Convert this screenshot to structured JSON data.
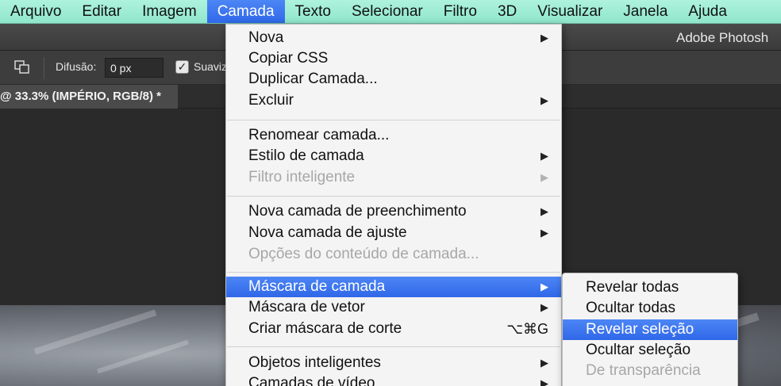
{
  "menubar": {
    "items": [
      "Arquivo",
      "Editar",
      "Imagem",
      "Camada",
      "Texto",
      "Selecionar",
      "Filtro",
      "3D",
      "Visualizar",
      "Janela",
      "Ajuda"
    ],
    "active": "Camada"
  },
  "titlebar": {
    "app_title": "Adobe Photosh"
  },
  "options": {
    "feather_label": "Difusão:",
    "feather_value": "0 px",
    "antialias_label": "Suaviz",
    "antialias_checked": true
  },
  "document": {
    "tab_title": "@ 33.3% (IMPÉRIO, RGB/8) *"
  },
  "menu": {
    "items": [
      {
        "label": "Nova",
        "submenu": true
      },
      {
        "label": "Copiar CSS"
      },
      {
        "label": "Duplicar Camada..."
      },
      {
        "label": "Excluir",
        "submenu": true
      },
      {
        "label": "Renomear camada..."
      },
      {
        "label": "Estilo de camada",
        "submenu": true
      },
      {
        "label": "Filtro inteligente",
        "submenu": true,
        "disabled": true
      },
      {
        "label": "Nova camada de preenchimento",
        "submenu": true
      },
      {
        "label": "Nova camada de ajuste",
        "submenu": true
      },
      {
        "label": "Opções do conteúdo de camada...",
        "disabled": true
      },
      {
        "label": "Máscara de camada",
        "submenu": true,
        "highlighted": true
      },
      {
        "label": "Máscara de vetor",
        "submenu": true
      },
      {
        "label": "Criar máscara de corte",
        "shortcut": "⌥⌘G"
      },
      {
        "label": "Objetos inteligentes",
        "submenu": true
      },
      {
        "label": "Camadas de vídeo",
        "submenu": true
      }
    ]
  },
  "submenu": {
    "items": [
      {
        "label": "Revelar todas"
      },
      {
        "label": "Ocultar todas"
      },
      {
        "label": "Revelar seleção",
        "highlighted": true
      },
      {
        "label": "Ocultar seleção"
      },
      {
        "label": "De transparência",
        "disabled": true
      }
    ]
  },
  "icons": {
    "submenu_arrow": "triangle-right-icon",
    "tool": "selection-mode-icon",
    "checkbox": "checkmark-icon"
  },
  "colors": {
    "menubar": "#9eecd4",
    "highlight": "#3a73ef",
    "menu_bg": "#f4f4f4",
    "disabled_text": "#a7a7a7"
  }
}
